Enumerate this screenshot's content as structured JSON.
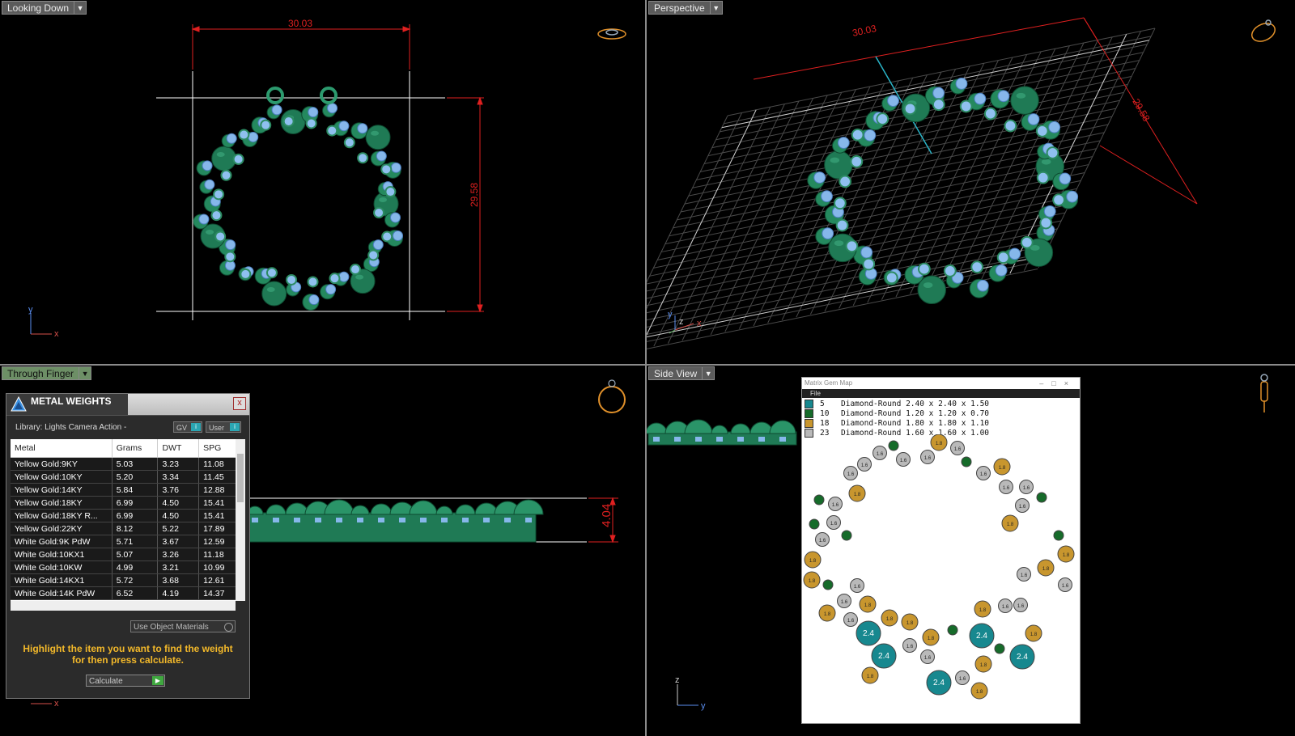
{
  "viewports": {
    "top_left": {
      "label": "Looking Down",
      "dim_width": "30.03",
      "dim_height": "29.58",
      "axis_x": "x",
      "axis_y": "y"
    },
    "top_right": {
      "label": "Perspective",
      "dim_width": "30.03",
      "dim_height": "29.58",
      "axis_x": "x",
      "axis_y": "y",
      "axis_z": "z"
    },
    "bottom_left": {
      "label": "Through Finger",
      "dim_depth": "4.04",
      "axis_x": "x"
    },
    "bottom_right": {
      "label": "Side View",
      "axis_z": "z",
      "axis_y": "y"
    }
  },
  "metal_weights": {
    "title": "METAL WEIGHTS",
    "close": "x",
    "library": "Library: Lights Camera Action -",
    "gv_btn": "GV",
    "user_btn": "User",
    "columns": [
      "Metal",
      "Grams",
      "DWT",
      "SPG"
    ],
    "rows": [
      [
        "Yellow Gold:9KY",
        "5.03",
        "3.23",
        "11.08"
      ],
      [
        "Yellow Gold:10KY",
        "5.20",
        "3.34",
        "11.45"
      ],
      [
        "Yellow Gold:14KY",
        "5.84",
        "3.76",
        "12.88"
      ],
      [
        "Yellow Gold:18KY",
        "6.99",
        "4.50",
        "15.41"
      ],
      [
        "Yellow Gold:18KY R...",
        "6.99",
        "4.50",
        "15.41"
      ],
      [
        "Yellow Gold:22KY",
        "8.12",
        "5.22",
        "17.89"
      ],
      [
        "White Gold:9K PdW",
        "5.71",
        "3.67",
        "12.59"
      ],
      [
        "White Gold:10KX1",
        "5.07",
        "3.26",
        "11.18"
      ],
      [
        "White Gold:10KW",
        "4.99",
        "3.21",
        "10.99"
      ],
      [
        "White Gold:14KX1",
        "5.72",
        "3.68",
        "12.61"
      ],
      [
        "White Gold:14K PdW",
        "6.52",
        "4.19",
        "14.37"
      ]
    ],
    "use_object_materials": "Use Object Materials",
    "message": "Highlight the item you want to find the weight for then press calculate.",
    "calculate": "Calculate"
  },
  "gem_map": {
    "title": "Matrix Gem Map",
    "menu": "File",
    "legend": [
      {
        "count": "5",
        "desc": "Diamond-Round 2.40 x 2.40 x 1.50",
        "color": "#17888f"
      },
      {
        "count": "10",
        "desc": "Diamond-Round 1.20 x 1.20 x 0.70",
        "color": "#166b2a"
      },
      {
        "count": "18",
        "desc": "Diamond-Round 1.80 x 1.80 x 1.10",
        "color": "#c8962e"
      },
      {
        "count": "23",
        "desc": "Diamond-Round 1.60 x 1.60 x 1.00",
        "color": "#b9b9b9"
      }
    ],
    "gem_labels": {
      "large": "2.4",
      "medium": "1.8",
      "small": "1.6"
    }
  }
}
